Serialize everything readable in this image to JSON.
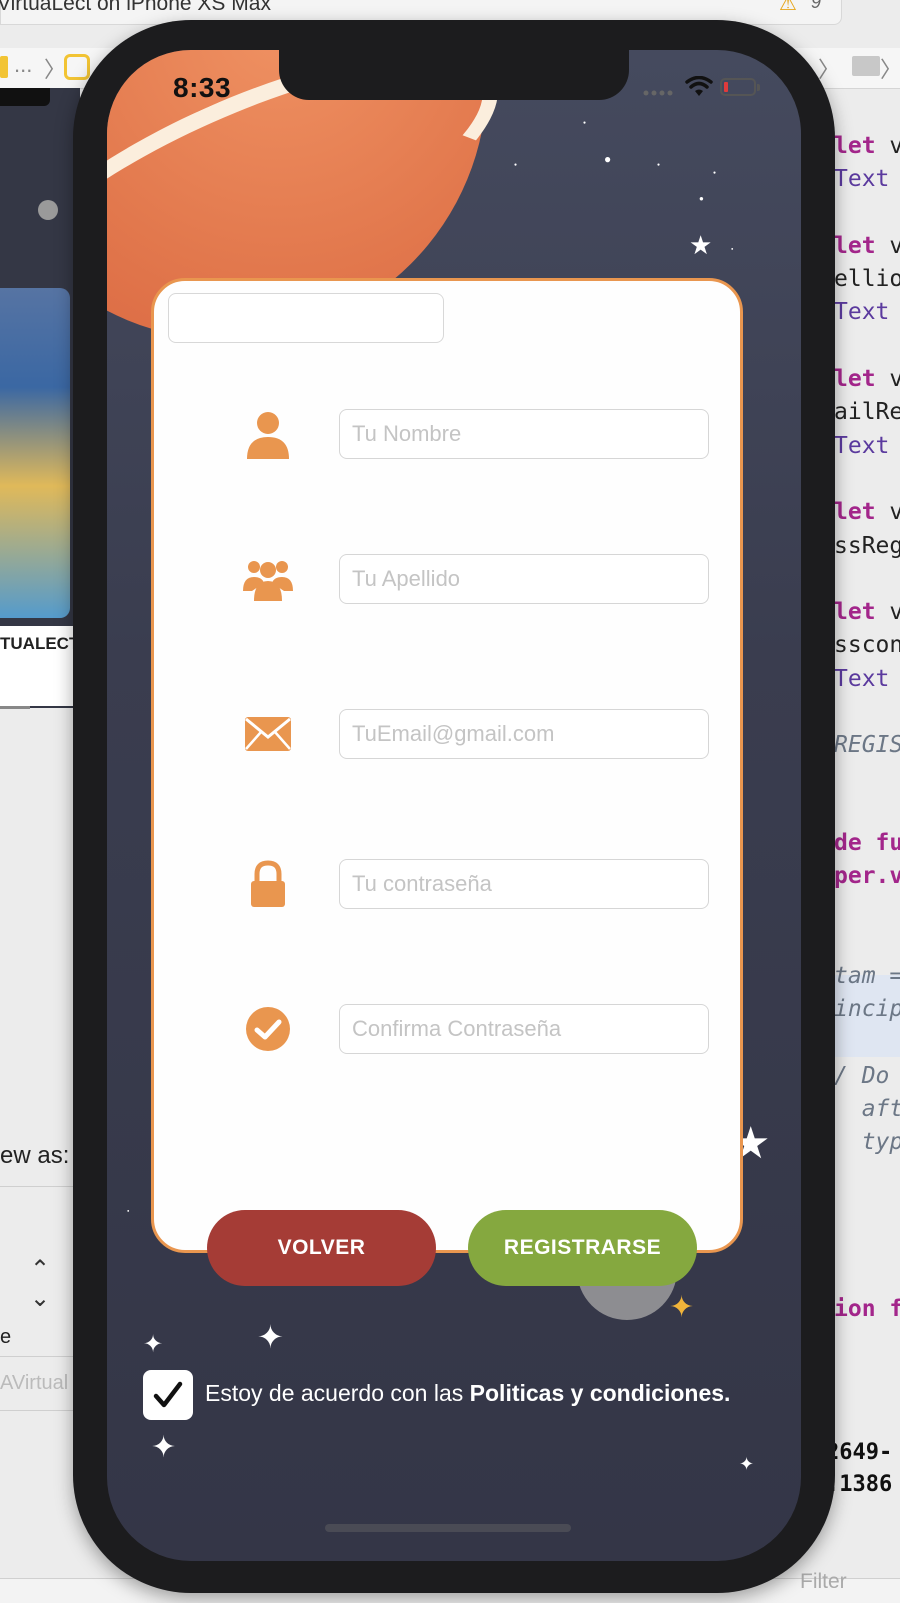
{
  "window": {
    "title": "VirtuaLect on iPhone XS Max",
    "warning_count": "9"
  },
  "jumpbar": {
    "ellipsis": "..."
  },
  "left_panel": {
    "app_word": "TUALECTO",
    "view_as_label": "ew as:",
    "row_label": "e",
    "field_hint": "AVirtual"
  },
  "code_lines": [
    {
      "kw": "let ",
      "rest": "v"
    },
    {
      "ty": "Text"
    },
    {
      "blank": ""
    },
    {
      "kw": "let ",
      "rest": "v"
    },
    {
      "pl": "ellio"
    },
    {
      "ty": "Text"
    },
    {
      "blank": ""
    },
    {
      "kw": "let ",
      "rest": "v"
    },
    {
      "pl": "ailRe"
    },
    {
      "ty": "Text"
    },
    {
      "blank": ""
    },
    {
      "kw": "let ",
      "rest": "v"
    },
    {
      "pl": "ssReg"
    },
    {
      "blank": ""
    },
    {
      "kw": "let ",
      "rest": "v"
    },
    {
      "pl": "sscon"
    },
    {
      "ty": "Text"
    },
    {
      "blank": ""
    },
    {
      "cm": "REGIS"
    }
  ],
  "code_lower": {
    "line1": "de fu",
    "line2": "per.v",
    "line3": "tam =",
    "line4": "incip",
    "line5": "/ Do a",
    "line6": "  aft",
    "line7": "  typ",
    "line8": "ion f"
  },
  "code_bottom": [
    "2649-",
    ":1386"
  ],
  "filter_placeholder": "Filter",
  "status_bar": {
    "time": "8:33"
  },
  "form": {
    "fields": [
      {
        "icon": "person-icon",
        "placeholder": "Tu Nombre"
      },
      {
        "icon": "group-icon",
        "placeholder": "Tu Apellido"
      },
      {
        "icon": "envelope-icon",
        "placeholder": "TuEmail@gmail.com"
      },
      {
        "icon": "lock-icon",
        "placeholder": "Tu contraseña"
      },
      {
        "icon": "check-circle-icon",
        "placeholder": "Confirma Contraseña"
      }
    ],
    "back_button": "VOLVER",
    "register_button": "REGISTRARSE",
    "terms_prefix": "Estoy de acuerdo con las ",
    "terms_link": "Politicas y condiciones.",
    "terms_checked": true
  },
  "colors": {
    "accent_orange": "#e9964f",
    "back_red": "#a53c36",
    "register_green": "#85a83f",
    "screen_bg": "#3a3d4f"
  }
}
